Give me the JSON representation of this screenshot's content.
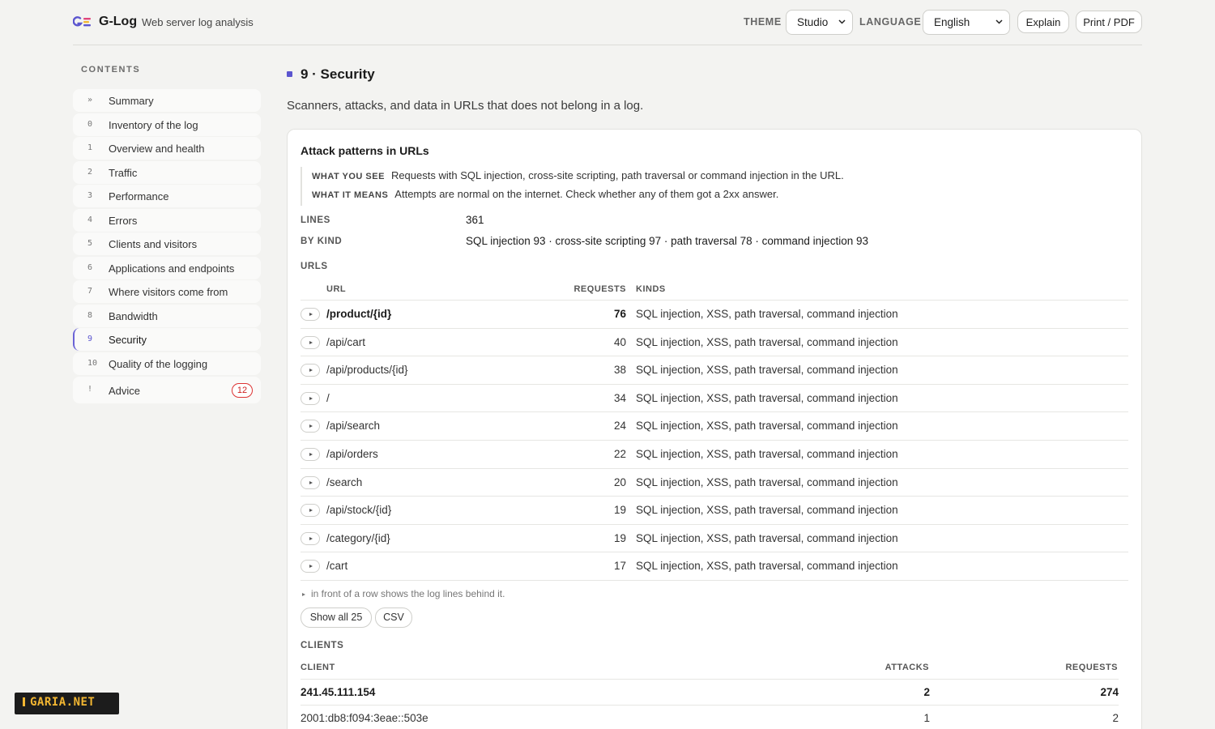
{
  "header": {
    "app_name": "G-Log",
    "app_subtitle": "Web server log analysis",
    "theme_label": "THEME",
    "theme_value": "Studio",
    "language_label": "LANGUAGE",
    "language_value": "English",
    "explain_label": "Explain",
    "print_label": "Print / PDF",
    "logo_colors": [
      "#5b55cf",
      "#e0457b",
      "#f2b632"
    ]
  },
  "sidebar": {
    "title": "CONTENTS",
    "items": [
      {
        "num": "»",
        "label": "Summary"
      },
      {
        "num": "0",
        "label": "Inventory of the log"
      },
      {
        "num": "1",
        "label": "Overview and health"
      },
      {
        "num": "2",
        "label": "Traffic"
      },
      {
        "num": "3",
        "label": "Performance"
      },
      {
        "num": "4",
        "label": "Errors"
      },
      {
        "num": "5",
        "label": "Clients and visitors"
      },
      {
        "num": "6",
        "label": "Applications and endpoints"
      },
      {
        "num": "7",
        "label": "Where visitors come from"
      },
      {
        "num": "8",
        "label": "Bandwidth"
      },
      {
        "num": "9",
        "label": "Security",
        "active": true
      },
      {
        "num": "10",
        "label": "Quality of the logging"
      },
      {
        "num": "!",
        "label": "Advice",
        "badge": "12"
      }
    ]
  },
  "section": {
    "title": "9 · Security",
    "description": "Scanners, attacks, and data in URLs that does not belong in a log."
  },
  "card": {
    "title": "Attack patterns in URLs",
    "what_you_see_key": "WHAT YOU SEE",
    "what_you_see": "Requests with SQL injection, cross-site scripting, path traversal or command injection in the URL.",
    "what_it_means_key": "WHAT IT MEANS",
    "what_it_means": "Attempts are normal on the internet. Check whether any of them got a 2xx answer.",
    "lines_key": "LINES",
    "lines_value": "361",
    "by_kind_key": "BY KIND",
    "by_kind_value": "SQL injection 93 · cross‑site scripting 97 · path traversal 78 · command injection 93",
    "urls_label": "URLS",
    "url_table": {
      "headers": {
        "url": "URL",
        "requests": "REQUESTS",
        "kinds": "KINDS"
      },
      "rows": [
        {
          "url": "/product/{id}",
          "requests": "76",
          "kinds": "SQL injection, XSS, path traversal, command injection"
        },
        {
          "url": "/api/cart",
          "requests": "40",
          "kinds": "SQL injection, XSS, path traversal, command injection"
        },
        {
          "url": "/api/products/{id}",
          "requests": "38",
          "kinds": "SQL injection, XSS, path traversal, command injection"
        },
        {
          "url": "/",
          "requests": "34",
          "kinds": "SQL injection, XSS, path traversal, command injection"
        },
        {
          "url": "/api/search",
          "requests": "24",
          "kinds": "SQL injection, XSS, path traversal, command injection"
        },
        {
          "url": "/api/orders",
          "requests": "22",
          "kinds": "SQL injection, XSS, path traversal, command injection"
        },
        {
          "url": "/search",
          "requests": "20",
          "kinds": "SQL injection, XSS, path traversal, command injection"
        },
        {
          "url": "/api/stock/{id}",
          "requests": "19",
          "kinds": "SQL injection, XSS, path traversal, command injection"
        },
        {
          "url": "/category/{id}",
          "requests": "19",
          "kinds": "SQL injection, XSS, path traversal, command injection"
        },
        {
          "url": "/cart",
          "requests": "17",
          "kinds": "SQL injection, XSS, path traversal, command injection"
        }
      ]
    },
    "hint": "in front of a row shows the log lines behind it.",
    "show_all_label": "Show all 25",
    "csv_label": "CSV",
    "clients_label": "CLIENTS",
    "client_table": {
      "headers": {
        "client": "CLIENT",
        "attacks": "ATTACKS",
        "requests": "REQUESTS"
      },
      "rows": [
        {
          "client": "241.45.111.154",
          "attacks": "2",
          "requests": "274"
        },
        {
          "client": "2001:db8:f094:3eae::503e",
          "attacks": "1",
          "requests": "2"
        }
      ]
    }
  },
  "watermark": "GARIA.NET"
}
